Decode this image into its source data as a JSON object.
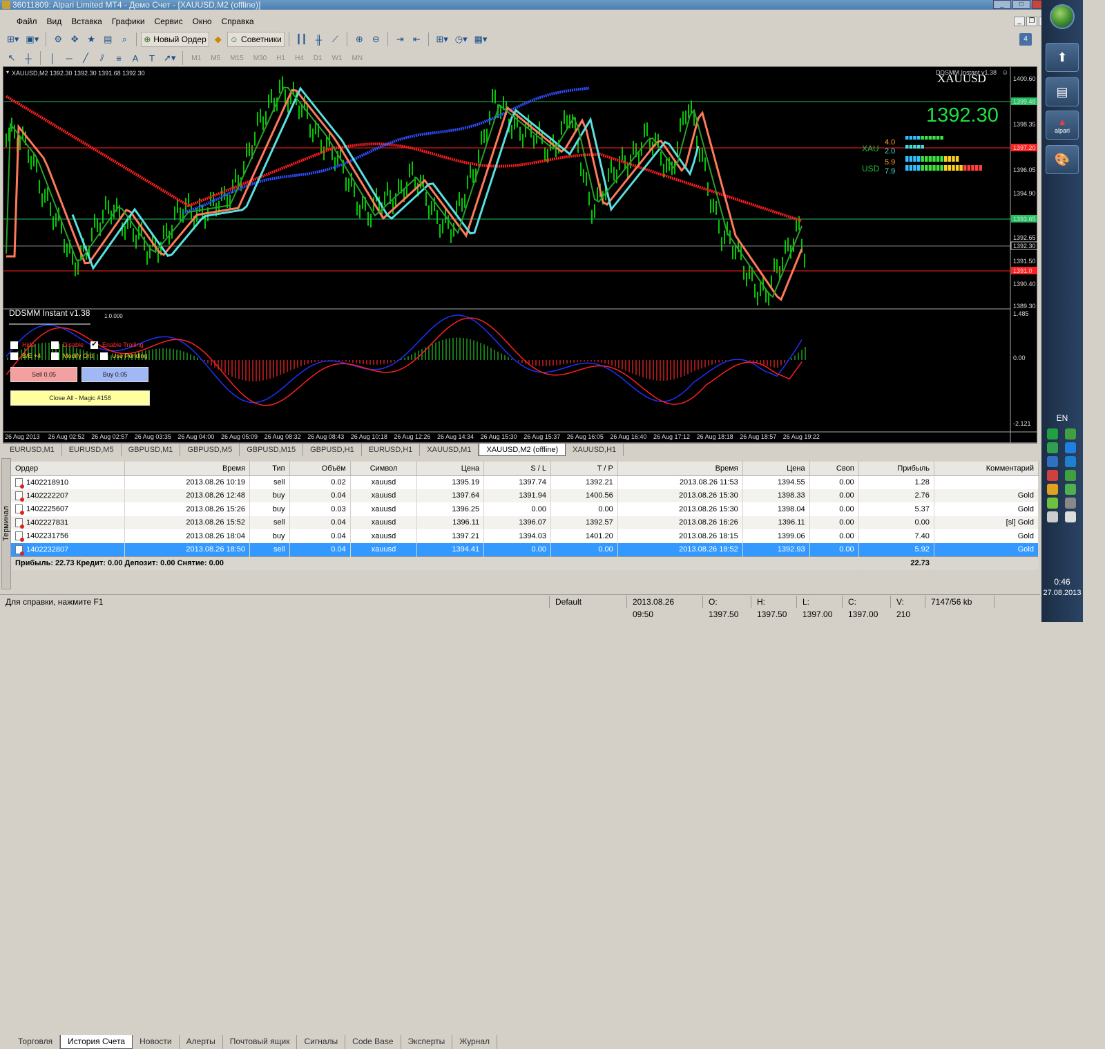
{
  "window": {
    "title": "36011809: Alpari Limited MT4 - Демо Счет - [XAUUSD,M2 (offline)]"
  },
  "menu": [
    "Файл",
    "Вид",
    "Вставка",
    "Графики",
    "Сервис",
    "Окно",
    "Справка"
  ],
  "toolbar": {
    "new_order": "Новый Ордер",
    "experts": "Советники",
    "timeframes": [
      "M1",
      "M5",
      "M15",
      "M30",
      "H1",
      "H4",
      "D1",
      "W1",
      "MN"
    ]
  },
  "chart": {
    "header": "XAUUSD,M2  1392.30 1392.30 1391.68 1392.30",
    "ea_name": "DDSMM Instant v1.38",
    "symbol_watermark": "XAUUSD",
    "big_price": "1392.30",
    "strength": {
      "xau_label": "XAU",
      "xau_v1": "4.0",
      "xau_v2": "2.0",
      "usd_label": "USD",
      "usd_v1": "5.9",
      "usd_v2": "7.9"
    },
    "price_labels": [
      "1400.60",
      "1399.48",
      "1398.35",
      "1397.20",
      "1396.05",
      "1394.90",
      "1393.65",
      "1392.65",
      "1392.30",
      "1391.50",
      "1391.0",
      "1390.40",
      "1389.30"
    ],
    "indicator_labels": [
      "1.485",
      "0.00",
      "-2.121"
    ],
    "indicator_title": "DDSMM Instant v1.38",
    "indicator_small": "1.0.000",
    "panel": {
      "hide": "Hide",
      "disable": "Disable",
      "enable_trailing": "Enable Trailing",
      "be": "B/E +4",
      "modify": "Modify Ord",
      "use_pending": "Use Pending",
      "sell": "Sell 0.05",
      "buy": "Buy 0.05",
      "close_all": "Close All - Magic #158"
    },
    "time_labels": [
      "26 Aug 2013",
      "26 Aug 02:52",
      "26 Aug 02:57",
      "26 Aug 03:35",
      "26 Aug 04:00",
      "26 Aug 05:09",
      "26 Aug 08:32",
      "26 Aug 08:43",
      "26 Aug 10:18",
      "26 Aug 12:26",
      "26 Aug 14:34",
      "26 Aug 15:30",
      "26 Aug 15:37",
      "26 Aug 16:05",
      "26 Aug 16:40",
      "26 Aug 17:12",
      "26 Aug 18:18",
      "26 Aug 18:57",
      "26 Aug 19:22"
    ]
  },
  "chart_tabs": [
    "EURUSD,M1",
    "EURUSD,M5",
    "GBPUSD,M1",
    "GBPUSD,M5",
    "GBPUSD,M15",
    "GBPUSD,H1",
    "EURUSD,H1",
    "XAUUSD,M1",
    "XAUUSD,M2 (offline)",
    "XAUUSD,H1"
  ],
  "history": {
    "columns": [
      "Ордер",
      "Время",
      "Тип",
      "Объём",
      "Символ",
      "Цена",
      "S / L",
      "T / P",
      "Время",
      "Цена",
      "Своп",
      "Прибыль",
      "Комментарий"
    ],
    "rows": [
      [
        "1402218910",
        "2013.08.26 10:19",
        "sell",
        "0.02",
        "xauusd",
        "1395.19",
        "1397.74",
        "1392.21",
        "2013.08.26 11:53",
        "1394.55",
        "0.00",
        "1.28",
        ""
      ],
      [
        "1402222207",
        "2013.08.26 12:48",
        "buy",
        "0.04",
        "xauusd",
        "1397.64",
        "1391.94",
        "1400.56",
        "2013.08.26 15:30",
        "1398.33",
        "0.00",
        "2.76",
        "Gold"
      ],
      [
        "1402225607",
        "2013.08.26 15:26",
        "buy",
        "0.03",
        "xauusd",
        "1396.25",
        "0.00",
        "0.00",
        "2013.08.26 15:30",
        "1398.04",
        "0.00",
        "5.37",
        "Gold"
      ],
      [
        "1402227831",
        "2013.08.26 15:52",
        "sell",
        "0.04",
        "xauusd",
        "1396.11",
        "1396.07",
        "1392.57",
        "2013.08.26 16:26",
        "1396.11",
        "0.00",
        "0.00",
        "[sl]   Gold"
      ],
      [
        "1402231756",
        "2013.08.26 18:04",
        "buy",
        "0.04",
        "xauusd",
        "1397.21",
        "1394.03",
        "1401.20",
        "2013.08.26 18:15",
        "1399.06",
        "0.00",
        "7.40",
        "Gold"
      ],
      [
        "1402232807",
        "2013.08.26 18:50",
        "sell",
        "0.04",
        "xauusd",
        "1394.41",
        "0.00",
        "0.00",
        "2013.08.26 18:52",
        "1392.93",
        "0.00",
        "5.92",
        "Gold"
      ]
    ],
    "summary": "Прибыль: 22.73  Кредит: 0.00  Депозит: 0.00  Снятие: 0.00",
    "summary_total": "22.73"
  },
  "terminal_label": "Терминал",
  "terminal_tabs": [
    "Торговля",
    "История Счета",
    "Новости",
    "Алерты",
    "Почтовый ящик",
    "Сигналы",
    "Code Base",
    "Эксперты",
    "Журнал"
  ],
  "status": [
    "Для справки, нажмите F1",
    "Default",
    "2013.08.26 09:50",
    "O: 1397.50",
    "H: 1397.50",
    "L: 1397.00",
    "C: 1397.00",
    "V: 210",
    "7147/56 kb"
  ],
  "taskbar": {
    "lang": "EN",
    "time": "0:46",
    "date": "27.08.2013",
    "alpari": "alpari"
  },
  "colors": {
    "bull": "#00c800",
    "fast_ma": "#ff7a5a",
    "cyan_ma": "#5ae0e0",
    "green_ma": "#2aa02a",
    "red_line": "#ff2020",
    "green_line": "#20c060"
  }
}
